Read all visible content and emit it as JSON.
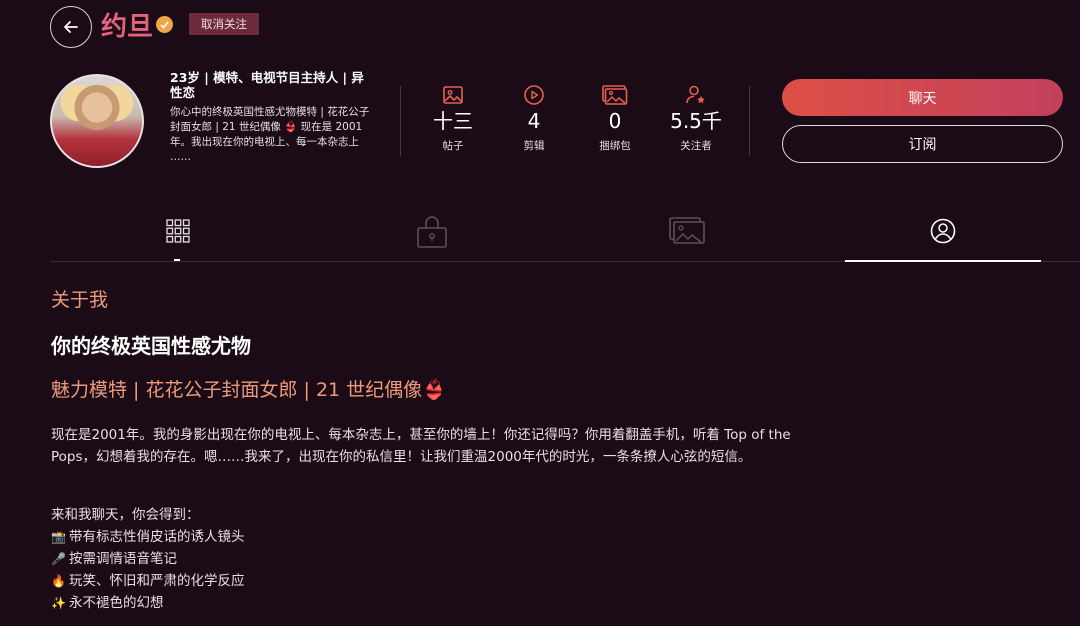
{
  "header": {
    "name": "约旦",
    "unfollow_label": "取消关注"
  },
  "profile": {
    "bio_title": "23岁 | 模特、电视节目主持人 | 异性恋",
    "bio_text": "你心中的终极英国性感尤物模特 | 花花公子封面女郎 | 21 世纪偶像 👙 现在是 2001 年。我出现在你的电视上、每一本杂志上 ……",
    "stats": [
      {
        "icon": "image-icon",
        "value": "十三",
        "label": "帖子"
      },
      {
        "icon": "play-icon",
        "value": "4",
        "label": "剪辑"
      },
      {
        "icon": "gallery-icon",
        "value": "0",
        "label": "捆绑包"
      },
      {
        "icon": "user-star-icon",
        "value": "5.5千",
        "label": "关注者"
      }
    ],
    "chat_label": "聊天",
    "subscribe_label": "订阅"
  },
  "tabs": [
    {
      "icon": "grid-icon"
    },
    {
      "icon": "lock-icon"
    },
    {
      "icon": "gallery-icon"
    },
    {
      "icon": "profile-icon",
      "active": true
    }
  ],
  "about": {
    "heading": "关于我",
    "title": "你的终极英国性感尤物",
    "subtitle": "魅力模特 | 花花公子封面女郎 | 21 世纪偶像👙",
    "paragraph": "现在是2001年。我的身影出现在你的电视上、每本杂志上，甚至你的墙上！你还记得吗？你用着翻盖手机，听着 Top of the Pops，幻想着我的存在。嗯……我来了，出现在你的私信里！让我们重温2000年代的时光，一条条撩人心弦的短信。",
    "list_intro": "来和我聊天，你会得到：",
    "list": [
      {
        "emoji": "📸",
        "text": "带有标志性俏皮话的诱人镜头"
      },
      {
        "emoji": "🎤",
        "text": "按需调情语音笔记"
      },
      {
        "emoji": "🔥",
        "text": "玩笑、怀旧和严肃的化学反应"
      },
      {
        "emoji": "✨",
        "text": "永不褪色的幻想"
      }
    ]
  },
  "colors": {
    "background": "#1a0b16",
    "accent": "#e2637e",
    "heading_accent": "#ec9a7b",
    "chat_gradient_start": "#dd4f45",
    "chat_gradient_end": "#c2405c"
  }
}
